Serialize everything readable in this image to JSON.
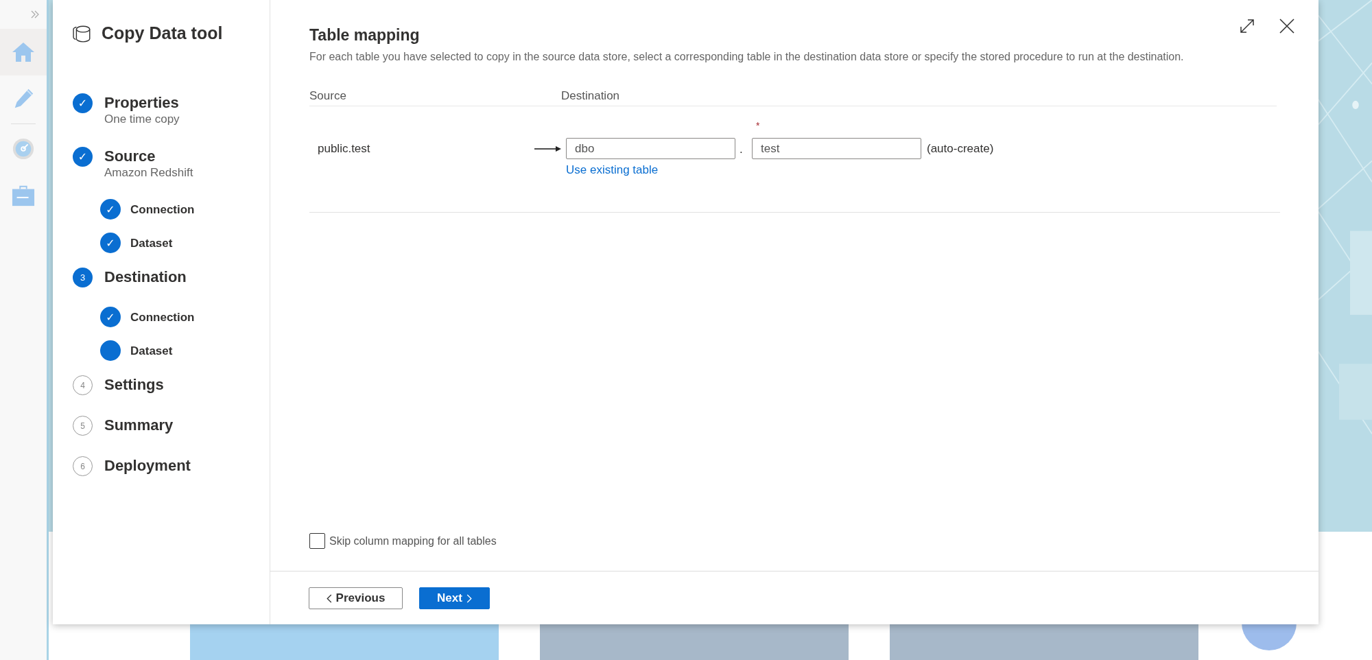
{
  "wizard": {
    "title": "Copy Data tool",
    "steps": [
      {
        "label": "Properties",
        "subtitle": "One time copy",
        "done": true,
        "marker": "✓"
      },
      {
        "label": "Source",
        "subtitle": "Amazon Redshift",
        "done": true,
        "marker": "✓",
        "children": [
          {
            "label": "Connection",
            "done": true,
            "marker": "✓"
          },
          {
            "label": "Dataset",
            "done": true,
            "marker": "✓"
          }
        ]
      },
      {
        "label": "Destination",
        "done": false,
        "current": true,
        "marker": "3",
        "children": [
          {
            "label": "Connection",
            "done": true,
            "marker": "✓"
          },
          {
            "label": "Dataset",
            "done": false,
            "current": true
          }
        ]
      },
      {
        "label": "Settings",
        "done": false,
        "current": false,
        "marker": "4"
      },
      {
        "label": "Summary",
        "done": false,
        "current": false,
        "marker": "5"
      },
      {
        "label": "Deployment",
        "done": false,
        "current": false,
        "marker": "6"
      }
    ]
  },
  "page": {
    "title": "Table mapping",
    "description": "For each table you have selected to copy in the source data store, select a corresponding table in the destination data store or specify the stored procedure to run at the destination.",
    "columns": [
      "Source",
      "Destination"
    ],
    "rows": [
      {
        "source": "public.test",
        "schema": {
          "value": "dbo"
        },
        "separator": ".",
        "required_mark": "*",
        "table": {
          "value": "test"
        },
        "note": "(auto-create)",
        "link": "Use existing table"
      }
    ],
    "skip_mapping": {
      "label": "Skip column mapping for all tables",
      "checked": false
    }
  },
  "footer": {
    "buttons": [
      {
        "label": "Previous",
        "kind": "back"
      },
      {
        "label": "Next",
        "kind": "next"
      }
    ]
  }
}
